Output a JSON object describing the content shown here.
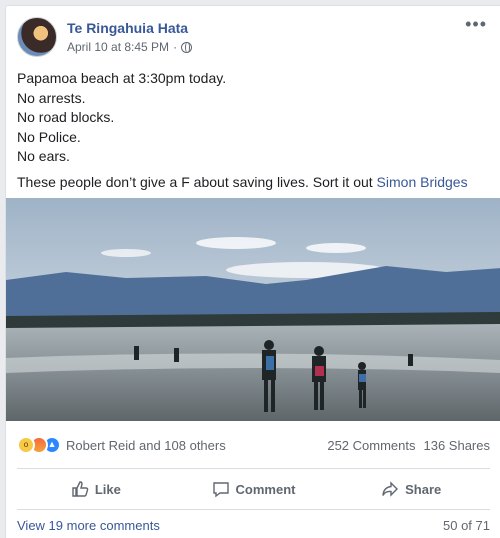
{
  "post": {
    "author": "Te Ringahuia Hata",
    "timestamp": "April 10 at 8:45 PM",
    "audience_icon": "globe-icon",
    "options_icon": "more-icon",
    "lines": [
      "Papamoa beach at 3:30pm today.",
      "No arrests.",
      "No road blocks.",
      "No Police.",
      "No ears."
    ],
    "closing_text": "These people don’t give a F about saving lives. Sort it out ",
    "mention": "Simon Bridges"
  },
  "reactions": {
    "icons": [
      "wow-icon",
      "angry-icon",
      "like-icon"
    ],
    "names": "Robert Reid and 108 others",
    "comments": "252 Comments",
    "shares": "136 Shares"
  },
  "actions": {
    "like": "Like",
    "comment": "Comment",
    "share": "Share"
  },
  "footer": {
    "view_more": "View 19 more comments",
    "count": "50 of 71"
  },
  "colors": {
    "link": "#385898",
    "muted": "#606770",
    "like_blue": "#2d88ff"
  }
}
